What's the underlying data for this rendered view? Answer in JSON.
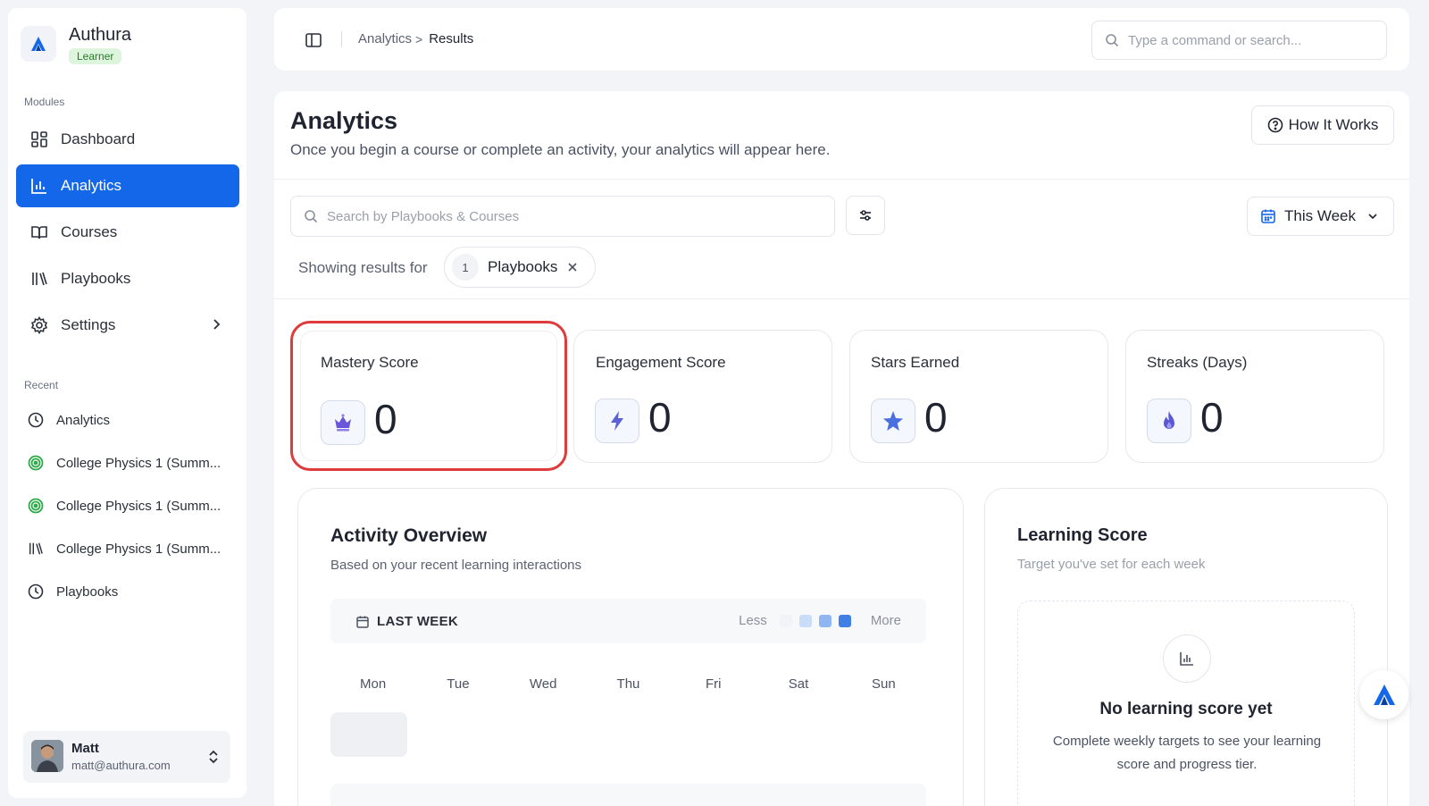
{
  "app": {
    "name": "Authura",
    "role_badge": "Learner"
  },
  "sidebar": {
    "modules_label": "Modules",
    "items": [
      {
        "label": "Dashboard",
        "icon": "dashboard-icon",
        "active": false
      },
      {
        "label": "Analytics",
        "icon": "bar-chart-icon",
        "active": true
      },
      {
        "label": "Courses",
        "icon": "book-open-icon",
        "active": false
      },
      {
        "label": "Playbooks",
        "icon": "library-icon",
        "active": false
      },
      {
        "label": "Settings",
        "icon": "gear-icon",
        "active": false,
        "has_chevron": true
      }
    ],
    "recent_label": "Recent",
    "recent": [
      {
        "label": "Analytics",
        "icon": "clock-icon"
      },
      {
        "label": "College Physics 1 (Summ...",
        "icon": "target-icon"
      },
      {
        "label": "College Physics 1 (Summ...",
        "icon": "target-icon"
      },
      {
        "label": "College Physics 1 (Summ...",
        "icon": "library-icon"
      },
      {
        "label": "Playbooks",
        "icon": "clock-icon"
      }
    ],
    "user": {
      "name": "Matt",
      "email": "matt@authura.com"
    }
  },
  "topbar": {
    "breadcrumb": {
      "parent": "Analytics",
      "separator": ">",
      "current": "Results"
    },
    "search_placeholder": "Type a command or search..."
  },
  "page": {
    "title": "Analytics",
    "subtitle": "Once you begin a course or complete an activity, your analytics will appear here.",
    "how_it_works": "How It Works",
    "search_placeholder": "Search by Playbooks & Courses",
    "range": "This Week",
    "showing_label": "Showing results for",
    "filter_chip": {
      "count": "1",
      "label": "Playbooks"
    }
  },
  "stats": [
    {
      "title": "Mastery Score",
      "value": "0",
      "icon": "crown-icon",
      "highlighted": true
    },
    {
      "title": "Engagement Score",
      "value": "0",
      "icon": "lightning-icon",
      "highlighted": false
    },
    {
      "title": "Stars Earned",
      "value": "0",
      "icon": "star-icon",
      "highlighted": false
    },
    {
      "title": "Streaks (Days)",
      "value": "0",
      "icon": "flame-icon",
      "highlighted": false
    }
  ],
  "activity": {
    "title": "Activity Overview",
    "subtitle": "Based on your recent learning interactions",
    "week_label": "LAST WEEK",
    "legend_less": "Less",
    "legend_more": "More",
    "legend_colors": [
      "#f1f3f6",
      "#c9dcf8",
      "#8fb6f0",
      "#3f7fe6"
    ],
    "days": [
      "Mon",
      "Tue",
      "Wed",
      "Thu",
      "Fri",
      "Sat",
      "Sun"
    ]
  },
  "learning_score": {
    "title": "Learning Score",
    "subtitle": "Target you've set for each week",
    "empty_title": "No learning score yet",
    "empty_text": "Complete weekly targets to see your learning score and progress tier."
  },
  "colors": {
    "accent": "#1467e8",
    "highlight_border": "#de3c3c",
    "badge_bg": "#dcf5dc",
    "badge_text": "#2b7a2b"
  }
}
